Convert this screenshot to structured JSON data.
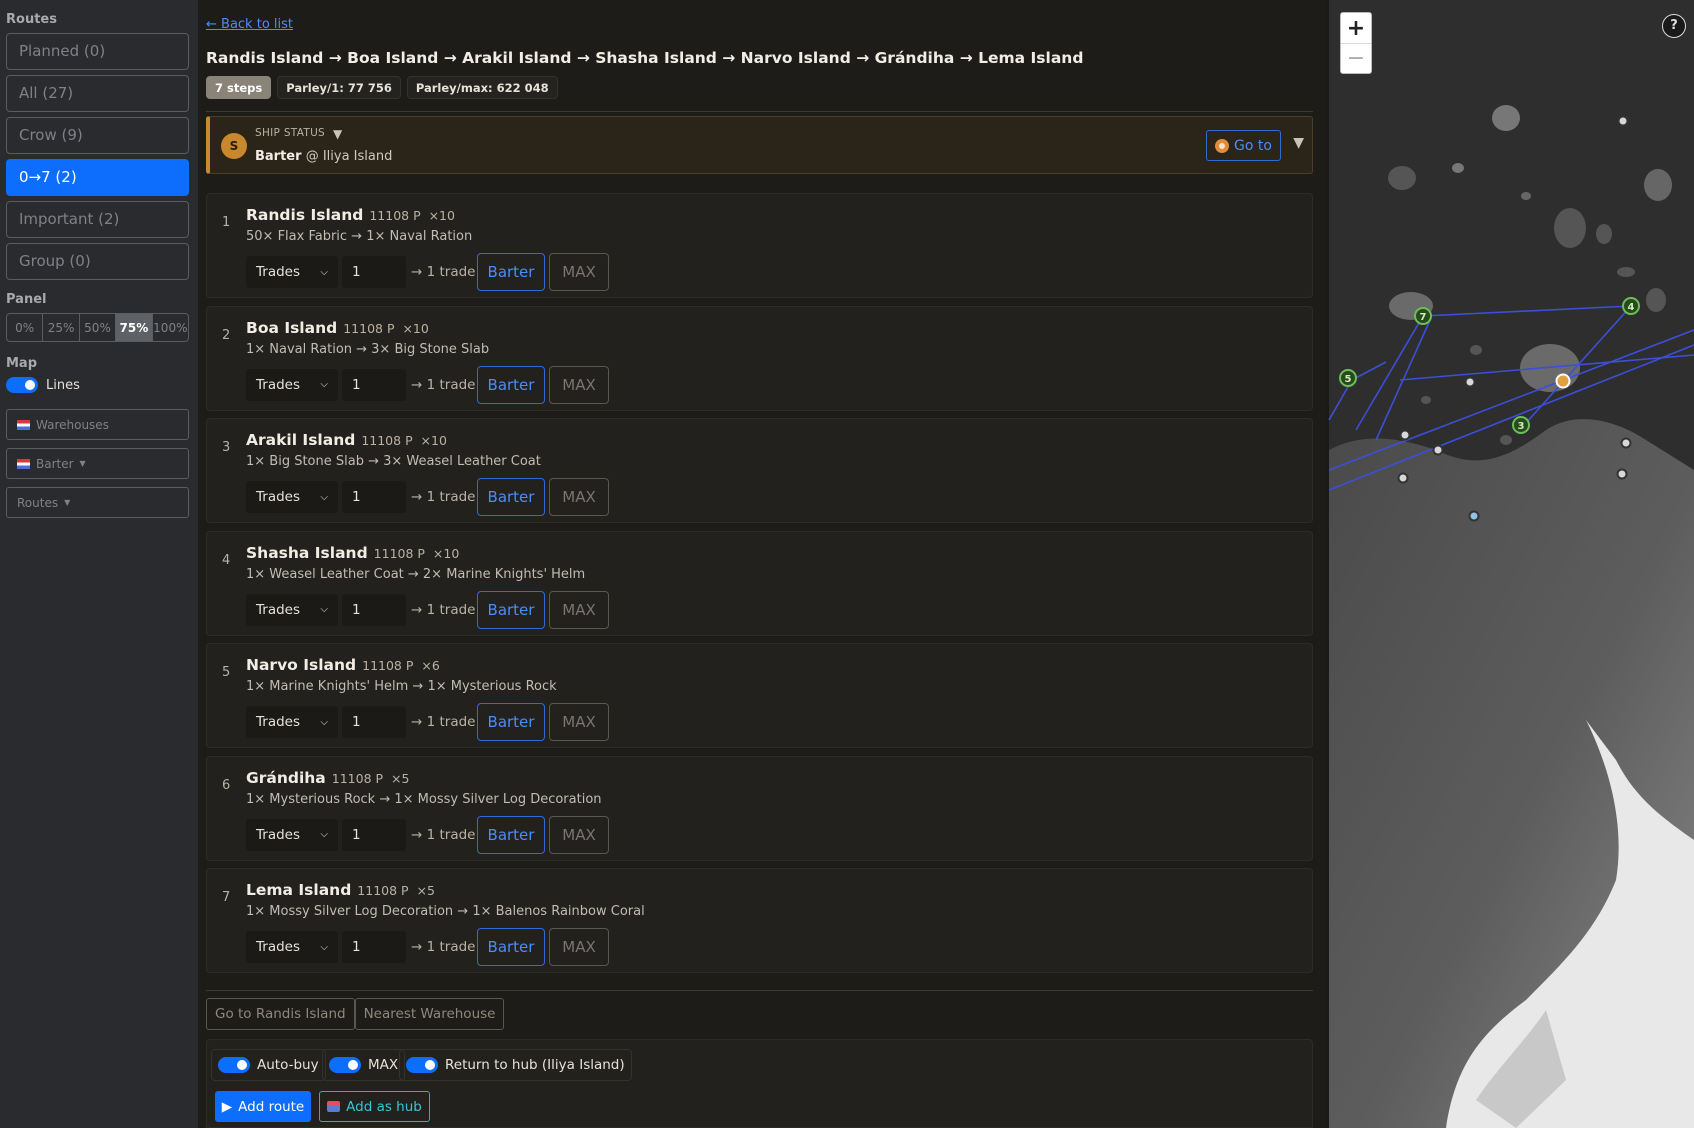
{
  "sidebar": {
    "routes_heading": "Routes",
    "routes": [
      {
        "label": "Planned (0)",
        "active": false
      },
      {
        "label": "All (27)",
        "active": false
      },
      {
        "label": "Crow (9)",
        "active": false
      },
      {
        "label": "0→7 (2)",
        "active": true
      },
      {
        "label": "Important (2)",
        "active": false
      },
      {
        "label": "Group (0)",
        "active": false
      }
    ],
    "panel_heading": "Panel",
    "panel_options": [
      "0%",
      "25%",
      "50%",
      "75%",
      "100%"
    ],
    "panel_selected": "75%",
    "map_heading": "Map",
    "lines_label": "Lines",
    "warehouses_label": "Warehouses",
    "barter_label": "Barter",
    "routes_select_label": "Routes"
  },
  "main": {
    "back_link": "← Back to list",
    "route_title": "Randis Island → Boa Island → Arakil Island → Shasha Island → Narvo Island → Grándiha → Lema Island",
    "badges": {
      "steps": "7 steps",
      "parley_one": "Parley/1: 77 756",
      "parley_max": "Parley/max: 622 048"
    },
    "ship": {
      "avatar": "S",
      "label": "SHIP STATUS",
      "caret": "▼",
      "status_bold": "Barter",
      "status_rest": "@ Iliya Island",
      "goto_label": "Go to",
      "collapse": "▼"
    },
    "trades_label": "Trades",
    "trade_suffix": "→ 1 trade",
    "barter_label": "Barter",
    "max_label": "MAX",
    "steps": [
      {
        "num": "1",
        "name": "Randis Island",
        "meta": "11108 P  ×10",
        "desc": "50× Flax Fabric → 1× Naval Ration",
        "qty": "1"
      },
      {
        "num": "2",
        "name": "Boa Island",
        "meta": "11108 P  ×10",
        "desc": "1× Naval Ration → 3× Big Stone Slab",
        "qty": "1"
      },
      {
        "num": "3",
        "name": "Arakil Island",
        "meta": "11108 P  ×10",
        "desc": "1× Big Stone Slab → 3× Weasel Leather Coat",
        "qty": "1"
      },
      {
        "num": "4",
        "name": "Shasha Island",
        "meta": "11108 P  ×10",
        "desc": "1× Weasel Leather Coat → 2× Marine Knights' Helm",
        "qty": "1"
      },
      {
        "num": "5",
        "name": "Narvo Island",
        "meta": "11108 P  ×6",
        "desc": "1× Marine Knights' Helm → 1× Mysterious Rock",
        "qty": "1"
      },
      {
        "num": "6",
        "name": "Grándiha",
        "meta": "11108 P  ×5",
        "desc": "1× Mysterious Rock → 1× Mossy Silver Log Decoration",
        "qty": "1"
      },
      {
        "num": "7",
        "name": "Lema Island",
        "meta": "11108 P  ×5",
        "desc": "1× Mossy Silver Log Decoration → 1× Balenos Rainbow Coral",
        "qty": "1"
      }
    ],
    "nav": {
      "goto_first": "Go to Randis Island",
      "nearest_warehouse": "Nearest Warehouse"
    },
    "options": {
      "auto_buy": "Auto-buy",
      "max": "MAX",
      "return_hub": "Return to hub (Iliya Island)"
    },
    "actions": {
      "add_route": "Add route",
      "add_hub": "Add as hub"
    }
  },
  "map": {
    "zoom_in": "+",
    "zoom_out": "−",
    "help": "?",
    "route_markers": [
      "7",
      "4",
      "5",
      "3"
    ]
  },
  "colors": {
    "accent": "#0d6efd",
    "ship_accent": "#c88a2e",
    "hub_button": "#1fb5c8",
    "marker_green": "#6bbf59"
  }
}
